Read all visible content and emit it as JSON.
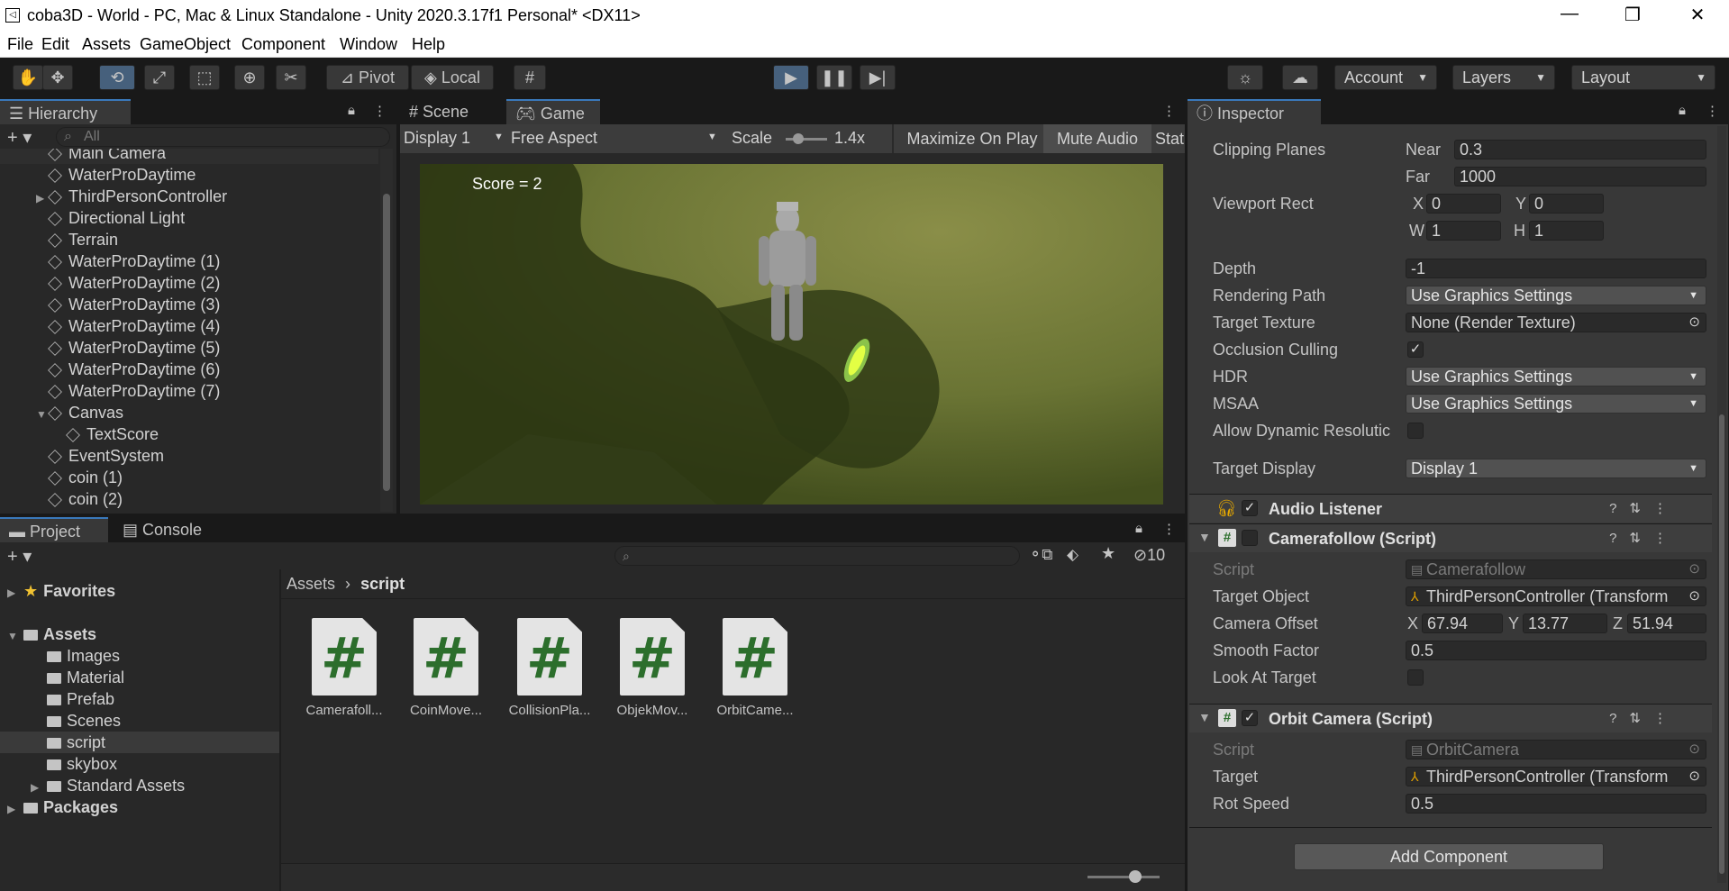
{
  "window": {
    "title": "coba3D - World - PC, Mac & Linux Standalone - Unity 2020.3.17f1 Personal* <DX11>",
    "controls": [
      "—",
      "❐",
      "✕"
    ]
  },
  "menu": [
    "File",
    "Edit",
    "Assets",
    "GameObject",
    "Component",
    "Window",
    "Help"
  ],
  "toolbar": {
    "pivot": "Pivot",
    "local": "Local",
    "account": "Account",
    "layers": "Layers",
    "layout": "Layout"
  },
  "hierarchy": {
    "tab": "Hierarchy",
    "search_placeholder": "All",
    "items": [
      {
        "label": "Main Camera",
        "indent": 1,
        "fold": "",
        "selected": true
      },
      {
        "label": "WaterProDaytime",
        "indent": 1,
        "fold": ""
      },
      {
        "label": "ThirdPersonController",
        "indent": 1,
        "fold": "▶"
      },
      {
        "label": "Directional Light",
        "indent": 1,
        "fold": ""
      },
      {
        "label": "Terrain",
        "indent": 1,
        "fold": ""
      },
      {
        "label": "WaterProDaytime (1)",
        "indent": 1,
        "fold": ""
      },
      {
        "label": "WaterProDaytime (2)",
        "indent": 1,
        "fold": ""
      },
      {
        "label": "WaterProDaytime (3)",
        "indent": 1,
        "fold": ""
      },
      {
        "label": "WaterProDaytime (4)",
        "indent": 1,
        "fold": ""
      },
      {
        "label": "WaterProDaytime (5)",
        "indent": 1,
        "fold": ""
      },
      {
        "label": "WaterProDaytime (6)",
        "indent": 1,
        "fold": ""
      },
      {
        "label": "WaterProDaytime (7)",
        "indent": 1,
        "fold": ""
      },
      {
        "label": "Canvas",
        "indent": 1,
        "fold": "▼"
      },
      {
        "label": "TextScore",
        "indent": 2,
        "fold": ""
      },
      {
        "label": "EventSystem",
        "indent": 1,
        "fold": ""
      },
      {
        "label": "coin (1)",
        "indent": 1,
        "fold": ""
      },
      {
        "label": "coin (2)",
        "indent": 1,
        "fold": ""
      }
    ]
  },
  "game": {
    "tabs": [
      "Scene",
      "Game"
    ],
    "display": "Display 1",
    "aspect": "Free Aspect",
    "scale_label": "Scale",
    "scale_value": "1.4x",
    "maximize": "Maximize On Play",
    "mute": "Mute Audio",
    "stats": "Stat",
    "score_text": "Score = 2"
  },
  "inspector": {
    "tab": "Inspector",
    "camera": {
      "clipping_label": "Clipping Planes",
      "near_label": "Near",
      "near": "0.3",
      "far_label": "Far",
      "far": "1000",
      "viewport_label": "Viewport Rect",
      "x_label": "X",
      "x": "0",
      "y_label": "Y",
      "y": "0",
      "w_label": "W",
      "w": "1",
      "h_label": "H",
      "h": "1",
      "depth_label": "Depth",
      "depth": "-1",
      "rendering_path_label": "Rendering Path",
      "rendering_path": "Use Graphics Settings",
      "target_texture_label": "Target Texture",
      "target_texture": "None (Render Texture)",
      "occlusion_label": "Occlusion Culling",
      "hdr_label": "HDR",
      "hdr": "Use Graphics Settings",
      "msaa_label": "MSAA",
      "msaa": "Use Graphics Settings",
      "dynres_label": "Allow Dynamic Resolutic",
      "target_display_label": "Target Display",
      "target_display": "Display 1"
    },
    "audio_listener": "Audio Listener",
    "camerafollow": {
      "title": "Camerafollow (Script)",
      "script_label": "Script",
      "script": "Camerafollow",
      "target_label": "Target Object",
      "target": "ThirdPersonController (Transform",
      "offset_label": "Camera Offset",
      "ox_label": "X",
      "ox": "67.94",
      "oy_label": "Y",
      "oy": "13.77",
      "oz_label": "Z",
      "oz": "51.94",
      "smooth_label": "Smooth Factor",
      "smooth": "0.5",
      "look_label": "Look At Target"
    },
    "orbit": {
      "title": "Orbit Camera (Script)",
      "script_label": "Script",
      "script": "OrbitCamera",
      "target_label": "Target",
      "target": "ThirdPersonController (Transform",
      "rot_label": "Rot Speed",
      "rot": "0.5"
    },
    "add_component": "Add Component"
  },
  "project": {
    "tabs": [
      "Project",
      "Console"
    ],
    "hidden_count": "10",
    "breadcrumb": [
      "Assets",
      "script"
    ],
    "tree": [
      {
        "label": "Favorites",
        "kind": "fav",
        "indent": 0,
        "fold": "▶",
        "bold": true
      },
      {
        "label": "Assets",
        "kind": "folder",
        "indent": 0,
        "fold": "▼",
        "bold": true
      },
      {
        "label": "Images",
        "kind": "folder",
        "indent": 1,
        "fold": ""
      },
      {
        "label": "Material",
        "kind": "folder",
        "indent": 1,
        "fold": ""
      },
      {
        "label": "Prefab",
        "kind": "folder",
        "indent": 1,
        "fold": ""
      },
      {
        "label": "Scenes",
        "kind": "folder",
        "indent": 1,
        "fold": ""
      },
      {
        "label": "script",
        "kind": "folder",
        "indent": 1,
        "fold": "",
        "selected": true
      },
      {
        "label": "skybox",
        "kind": "folder",
        "indent": 1,
        "fold": ""
      },
      {
        "label": "Standard Assets",
        "kind": "folder",
        "indent": 1,
        "fold": "▶"
      },
      {
        "label": "Packages",
        "kind": "folder",
        "indent": 0,
        "fold": "▶",
        "bold": true
      }
    ],
    "assets": [
      "Camerafoll...",
      "CoinMove...",
      "CollisionPla...",
      "ObjekMov...",
      "OrbitCame..."
    ]
  }
}
